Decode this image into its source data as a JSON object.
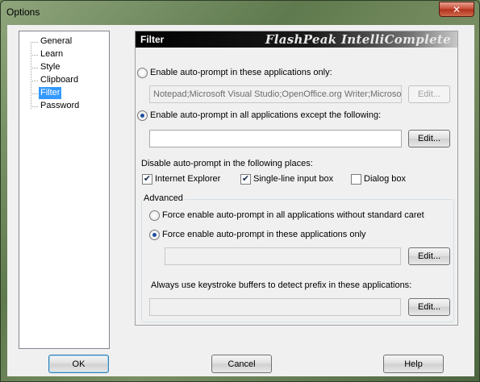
{
  "window": {
    "title": "Options",
    "close_label": "✕"
  },
  "tree": {
    "items": [
      {
        "label": "General"
      },
      {
        "label": "Learn"
      },
      {
        "label": "Style"
      },
      {
        "label": "Clipboard"
      },
      {
        "label": "Filter",
        "selected": true
      },
      {
        "label": "Password"
      }
    ]
  },
  "panel": {
    "title": "Filter",
    "brand": "FlashPeak IntelliComplete",
    "option_only": {
      "label": "Enable auto-prompt in these applications only:",
      "value": "Notepad;Microsoft Visual Studio;OpenOffice.org Writer;Microso",
      "edit_label": "Edit..."
    },
    "option_except": {
      "label": "Enable auto-prompt in all applications except the following:",
      "value": "",
      "edit_label": "Edit..."
    },
    "disable_heading": "Disable auto-prompt in the following places:",
    "checks": {
      "ie": {
        "label": "Internet Explorer",
        "checked": true
      },
      "single_line": {
        "label": "Single-line input box",
        "checked": true
      },
      "dialog": {
        "label": "Dialog box",
        "checked": false
      }
    },
    "advanced": {
      "title": "Advanced",
      "force_all": {
        "label": "Force enable auto-prompt in all applications without standard caret"
      },
      "force_these": {
        "label": "Force enable auto-prompt in these applications only",
        "value": "",
        "edit_label": "Edit..."
      },
      "keystroke": {
        "label": "Always use keystroke buffers to detect prefix in these applications:",
        "value": "",
        "edit_label": "Edit..."
      }
    }
  },
  "footer": {
    "ok_label": "OK",
    "cancel_label": "Cancel",
    "help_label": "Help"
  },
  "checkmark": "✔"
}
